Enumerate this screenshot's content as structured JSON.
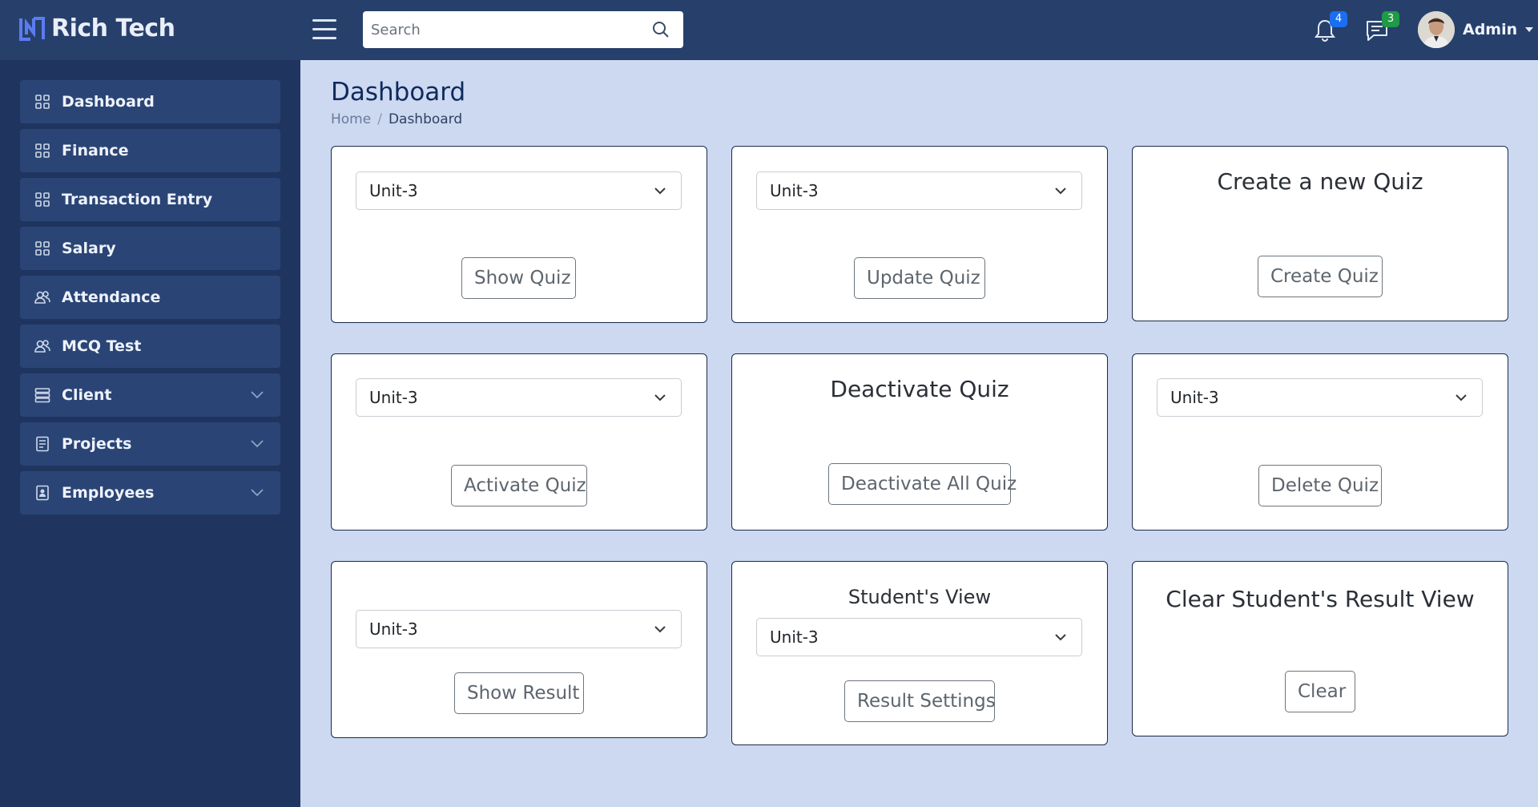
{
  "app": {
    "brand": "Rich Tech"
  },
  "header": {
    "search_placeholder": "Search",
    "notifications_count": "4",
    "messages_count": "3",
    "user_name": "Admin"
  },
  "sidebar": {
    "items": [
      {
        "label": "Dashboard",
        "icon": "grid-icon"
      },
      {
        "label": "Finance",
        "icon": "grid-icon"
      },
      {
        "label": "Transaction Entry",
        "icon": "grid-icon"
      },
      {
        "label": "Salary",
        "icon": "grid-icon"
      },
      {
        "label": "Attendance",
        "icon": "users-icon"
      },
      {
        "label": "MCQ Test",
        "icon": "users-icon"
      },
      {
        "label": "Client",
        "icon": "server-icon",
        "expandable": true
      },
      {
        "label": "Projects",
        "icon": "document-icon",
        "expandable": true
      },
      {
        "label": "Employees",
        "icon": "badge-icon",
        "expandable": true
      }
    ]
  },
  "page": {
    "title": "Dashboard",
    "breadcrumb": {
      "home": "Home",
      "separator": "/",
      "current": "Dashboard"
    }
  },
  "cards": {
    "show_quiz": {
      "select_value": "Unit-3",
      "button": "Show Quiz"
    },
    "update_quiz": {
      "select_value": "Unit-3",
      "button": "Update Quiz"
    },
    "create_quiz": {
      "title": "Create a new Quiz",
      "button": "Create Quiz"
    },
    "activate_quiz": {
      "select_value": "Unit-3",
      "button": "Activate Quiz"
    },
    "deactivate_quiz": {
      "title": "Deactivate Quiz",
      "button": "Deactivate All Quiz"
    },
    "delete_quiz": {
      "select_value": "Unit-3",
      "button": "Delete Quiz"
    },
    "show_result": {
      "select_value": "Unit-3",
      "button": "Show Result"
    },
    "students_view": {
      "title": "Student's View",
      "select_value": "Unit-3",
      "button": "Result Settings"
    },
    "clear_results": {
      "title": "Clear Student's Result View",
      "button": "Clear"
    }
  },
  "colors": {
    "header_bg": "#27406b",
    "sidebar_bg": "#1f3560",
    "sidebar_item_bg": "#2a4575",
    "content_bg": "#cdd9f1",
    "notification_badge": "#1a6ff0",
    "message_badge": "#1f9a46"
  }
}
